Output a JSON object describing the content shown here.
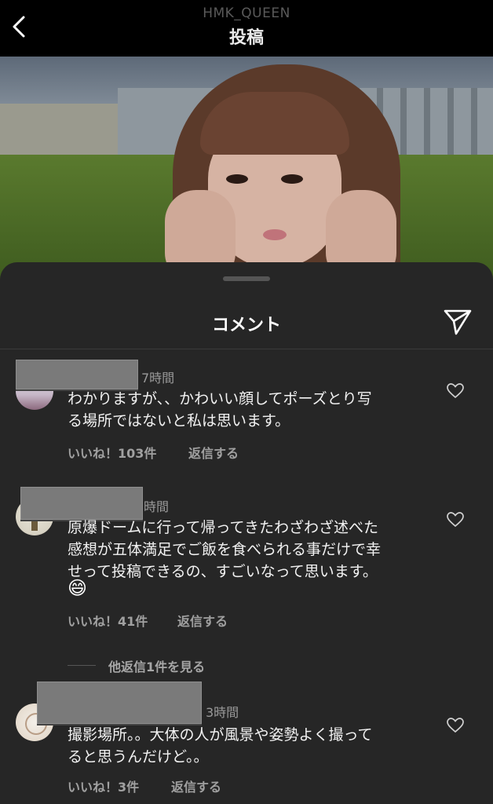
{
  "header": {
    "username": "HMK_QUEEN",
    "title": "投稿"
  },
  "sheet": {
    "title": "コメント"
  },
  "comments": [
    {
      "time": "7時間",
      "text_lines": [
        "わかりますが、、かわいい顔してポーズとり写",
        "る場所ではないと私は思います。"
      ],
      "likes": "いいね！103件",
      "reply": "返信する"
    },
    {
      "time": "時間",
      "text_lines": [
        "原爆ドームに行って帰ってきたわざわざ述べた",
        "感想が五体満足でご飯を食べられる事だけで幸",
        "せって投稿できるの、すごいなって思います。"
      ],
      "emoji": "😄",
      "likes": "いいね！41件",
      "reply": "返信する",
      "view_replies": "他返信1件を見る"
    },
    {
      "time": "3時間",
      "text_lines": [
        "撮影場所。。大体の人が風景や姿勢よく撮って",
        "ると思うんだけど。。"
      ],
      "likes": "いいね！3件",
      "reply": "返信する"
    }
  ],
  "colors": {
    "background": "#000000",
    "sheet": "#262626",
    "secondary_text": "#a0a0a0"
  }
}
